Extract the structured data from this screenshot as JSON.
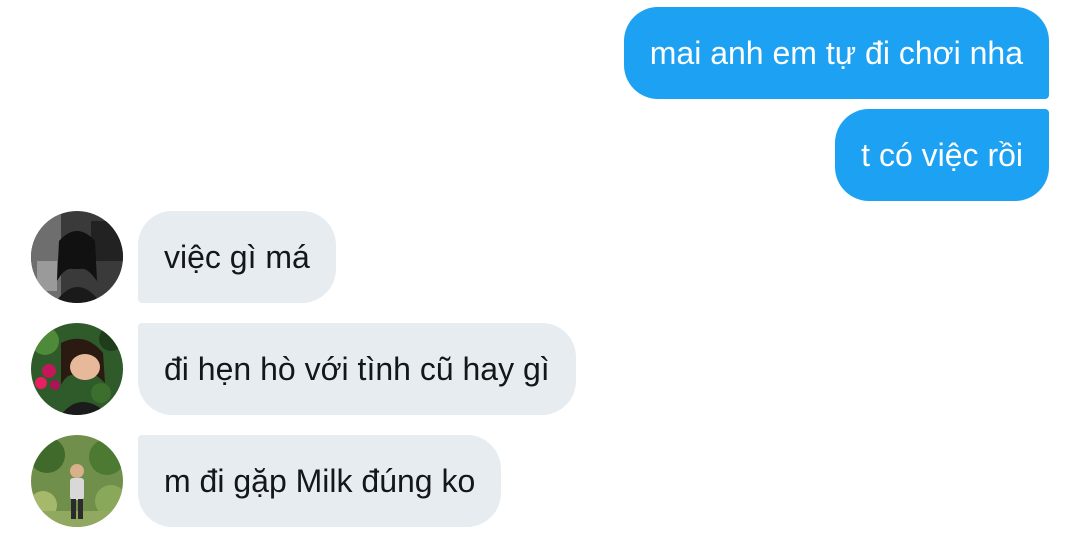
{
  "conversation": {
    "messages": [
      {
        "direction": "sent",
        "text": "mai anh em tự đi chơi nha"
      },
      {
        "direction": "sent",
        "text": "t có việc rồi"
      },
      {
        "direction": "received",
        "text": "việc gì má",
        "avatar": "user-avatar-bw-photo"
      },
      {
        "direction": "received",
        "text": "đi hẹn hò với tình cũ hay gì",
        "avatar": "user-avatar-flower-photo"
      },
      {
        "direction": "received",
        "text": "m đi gặp Milk đúng ko",
        "avatar": "user-avatar-garden-photo"
      }
    ]
  },
  "colors": {
    "sent_bubble": "#1da1f2",
    "received_bubble": "#e6ecf0",
    "sent_text": "#ffffff",
    "received_text": "#14171a"
  }
}
